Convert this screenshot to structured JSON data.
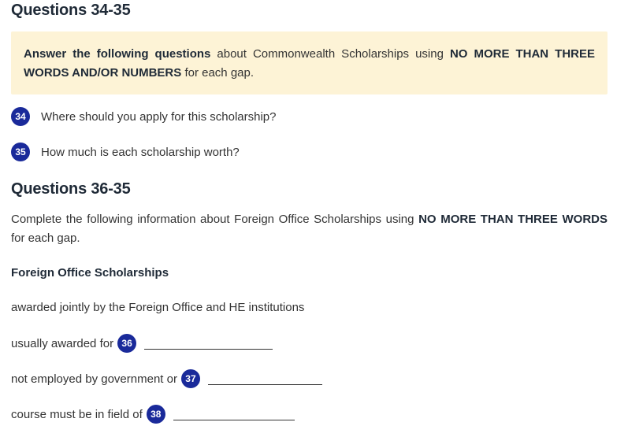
{
  "section1": {
    "title": "Questions 34-35",
    "instruction": {
      "bold1": "Answer the following questions",
      "text1": " about Commonwealth Scholarships using ",
      "bold2": "NO MORE THAN THREE WORDS AND/OR NUMBERS",
      "text2": " for each gap."
    },
    "questions": [
      {
        "number": "34",
        "text": "Where should you apply for this scholarship?"
      },
      {
        "number": "35",
        "text": "How much is each scholarship worth?"
      }
    ]
  },
  "section2": {
    "title": "Questions 36-35",
    "instruction": {
      "text1": "Complete the following information about Foreign Office Scholarships using ",
      "bold1": "NO MORE THAN THREE WORDS",
      "text2": " for each gap."
    },
    "subheading": "Foreign Office Scholarships",
    "line1": "awarded jointly by the Foreign Office and HE institutions",
    "gaps": [
      {
        "label": "usually awarded for",
        "number": "36",
        "value": ""
      },
      {
        "label": "not employed by government or",
        "number": "37",
        "value": ""
      },
      {
        "label": "course must be in field of",
        "number": "38",
        "value": ""
      }
    ]
  },
  "colors": {
    "badge": "#1a2a9a",
    "instruction_bg": "#fdf3d6",
    "heading": "#1f2a37",
    "text": "#333333"
  }
}
